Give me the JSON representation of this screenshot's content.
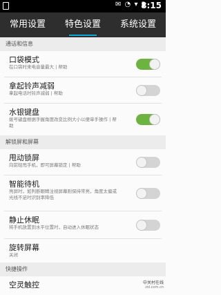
{
  "status_bar": {
    "time": "8:15",
    "icons": "✉ ◔ ▾ ▮"
  },
  "tabs": [
    {
      "label": "常用设置"
    },
    {
      "label": "特色设置"
    },
    {
      "label": "系统设置"
    }
  ],
  "sections": {
    "notify": "通话和信息",
    "lock": "解锁屏和屏幕",
    "shortcut": "快捷操作"
  },
  "settings": {
    "pocket": {
      "title": "口袋模式",
      "sub": "在口袋时来电音量最大 | 帮助",
      "enabled": true
    },
    "pickup": {
      "title": "拿起铃声减弱",
      "sub": "拿起电话时铃声减弱 | 帮助",
      "enabled": false
    },
    "watermark_keypad": {
      "title": "水银键盘",
      "sub": "拨号键盘根据手握角度改变比例大小以便单手操作 | 帮助",
      "enabled": true
    },
    "shake_lock": {
      "title": "甩动锁屏",
      "sub": "向前轻甩手机，即可屏幕锁定 | 帮助",
      "enabled": false
    },
    "smart_standby": {
      "title": "智能待机",
      "sub": "亮屏时，如判断眼睛注视屏幕则保持常亮，角度太偏或光线不足时识别率降低",
      "enabled": false
    },
    "static_sleep": {
      "title": "静止休眠",
      "sub": "将手机放置到水平位置时，自动进入休眠状态",
      "enabled": false
    },
    "rotate_screen": {
      "title": "旋转屏幕",
      "sub": "关闭"
    },
    "air_touch": {
      "title": "空灵触控"
    }
  },
  "watermark": {
    "line1": "中关村在线",
    "line2": "zol.com.cn"
  }
}
